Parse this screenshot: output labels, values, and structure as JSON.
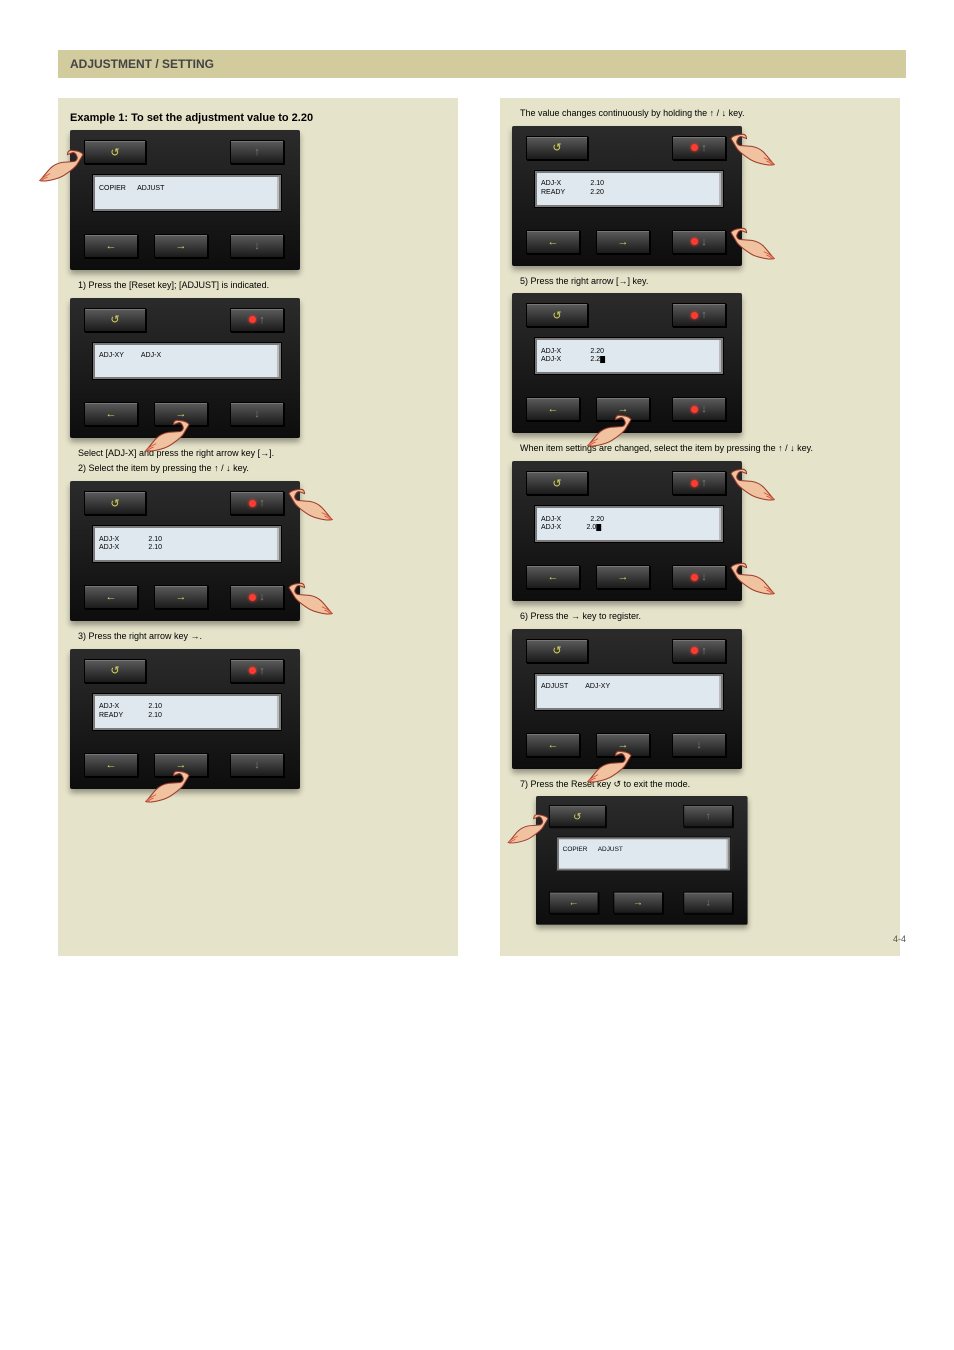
{
  "title_bar": "ADJUSTMENT / SETTING",
  "left": {
    "heading": "Example 1: To set the adjustment value to 2.20",
    "panels": [
      {
        "line1": "COPIER      ADJUST",
        "line2": "                  ",
        "step": "1) Press the [Reset key]; [ADJUST] is indicated.",
        "hands": [
          {
            "pos": "reset"
          }
        ],
        "dots": []
      },
      {
        "line1": "ADJ-XY         ADJ-X",
        "line2": "                  ",
        "step": "Select [ADJ-X] and press the right arrow key [→].",
        "hands": [
          {
            "pos": "right-btm"
          }
        ],
        "dots": [
          "up"
        ]
      },
      {
        "line1": "ADJ-X               2.10",
        "line2": "ADJ-X               2.10",
        "step": "2) Select the item by pressing the [↑] / [↓] key.",
        "hands": [
          {
            "pos": "up-right",
            "flip": true
          },
          {
            "pos": "down-right",
            "flip": true
          }
        ],
        "dots": [
          "up",
          "down"
        ]
      },
      {
        "line1": "ADJ-X               2.10",
        "line2": "READY             2.10",
        "step": "3) Press the right arrow key [→].",
        "hands": [
          {
            "pos": "right-btm"
          }
        ],
        "dots": [
          "up"
        ]
      }
    ]
  },
  "arrow_between": "↓",
  "right": {
    "heading_pre": "The value changes continuously by holding the [↑] /",
    "heading_post": " key.",
    "arrow_down": "↓",
    "panels": [
      {
        "line1": "ADJ-X               2.10",
        "line2": "READY             2.20",
        "step_before": "",
        "step_after": "5) Press the right arrow [→] key.",
        "hands": [
          {
            "pos": "up-right",
            "flip": true
          },
          {
            "pos": "down-right",
            "flip": true
          }
        ],
        "dots": [
          "up",
          "down"
        ]
      },
      {
        "line1": "ADJ-X               2.20",
        "line2": "ADJ-X               2.2█",
        "step_after": "When item settings are changed, select the item by pressing the [↑] / [↓] key.",
        "hands": [
          {
            "pos": "right-btm"
          }
        ],
        "dots": [
          "up",
          "down"
        ]
      },
      {
        "line1": "ADJ-X               2.20",
        "line2": "ADJ-X             2.0█",
        "step_after": "6) Press the [→] key to register.",
        "hands": [
          {
            "pos": "up-right",
            "flip": true
          },
          {
            "pos": "down-right",
            "flip": true
          }
        ],
        "dots": [
          "up",
          "down"
        ]
      },
      {
        "line1": "ADJUST         ADJ-XY",
        "line2": "                  ",
        "step_after": "7) Press the Reset key (↺) to exit the mode.",
        "hands": [
          {
            "pos": "right-btm"
          }
        ],
        "dots": [
          "up"
        ]
      },
      {
        "line1": "COPIER      ADJUST",
        "line2": "                  ",
        "step_after": "",
        "hands": [
          {
            "pos": "reset"
          }
        ],
        "dots": []
      }
    ]
  },
  "footnote": "4-4"
}
